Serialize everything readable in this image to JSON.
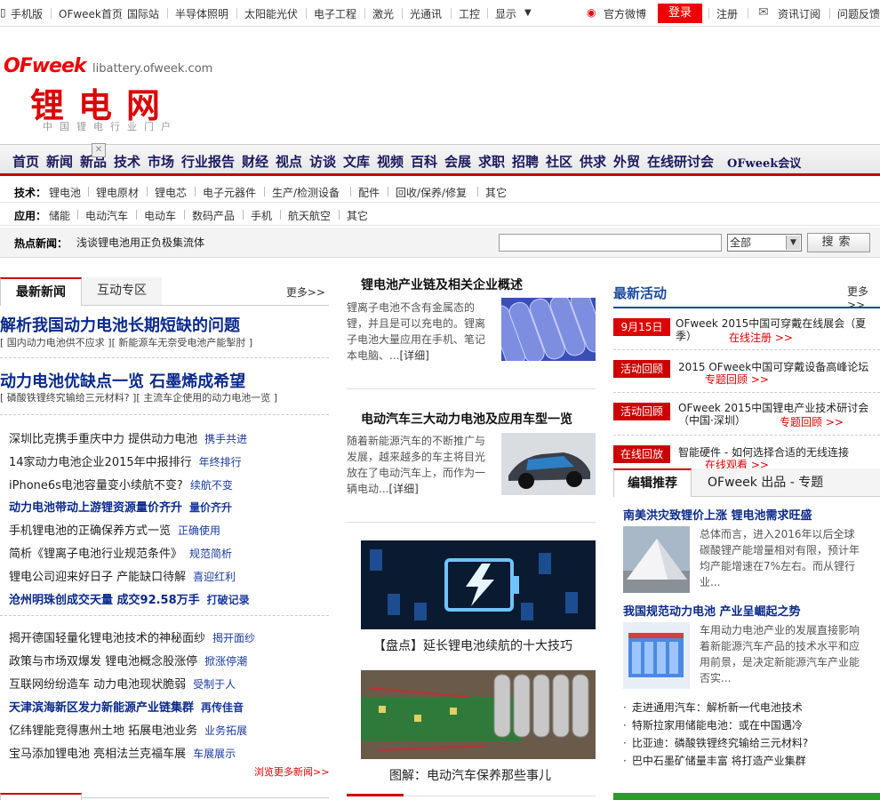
{
  "topbar": {
    "items": [
      "手机版",
      "OFweek首页",
      "国际站",
      "半导体照明",
      "太阳能光伏",
      "电子工程",
      "激光",
      "光通讯",
      "工控",
      "显示"
    ],
    "weibo": "官方微博",
    "login": "登录",
    "register": "注册",
    "subscribe": "资讯订阅",
    "feedback": "问题反馈"
  },
  "logo": {
    "brand": "OFweek",
    "domain": "libattery.ofweek.com",
    "title": "锂电网",
    "slogan": "中国锂电行业门户"
  },
  "mainnav": [
    "首页",
    "新闻",
    "新品",
    "技术",
    "市场",
    "行业报告",
    "财经",
    "视点",
    "访谈",
    "文库",
    "视频",
    "百科",
    "会展",
    "求职",
    "招聘",
    "社区",
    "供求",
    "外贸",
    "在线研讨会",
    "OFweek会议"
  ],
  "tech": {
    "label": "技术：",
    "items": [
      "锂电池",
      "锂电原材",
      "锂电芯",
      "电子元器件",
      "生产/检测设备",
      "配件",
      "回收/保养/修复",
      "其它"
    ]
  },
  "apply": {
    "label": "应用：",
    "items": [
      "储能",
      "电动汽车",
      "电动车",
      "数码产品",
      "手机",
      "航天航空",
      "其它"
    ]
  },
  "hot": {
    "label": "热点新闻：",
    "link": "浅谈锂电池用正负极集流体"
  },
  "search": {
    "value": "",
    "select": "全部",
    "button": "搜索"
  },
  "left": {
    "tab_news": "最新新闻",
    "tab_interact": "互动专区",
    "more": "更多>>",
    "headline1": "解析我国动力电池长期短缺的问题",
    "sub1": "[ 国内动力电池供不应求 ][ 新能源车无奈受电池产能掣肘 ]",
    "headline2": "动力电池优缺点一览 石墨烯成希望",
    "sub2": "[ 磷酸铁锂终究输给三元材料? ][ 主流车企使用的动力电池一览 ]",
    "list1": [
      {
        "text": "深圳比克携手重庆中力 提供动力电池",
        "tag": "携手共进",
        "bold": false
      },
      {
        "text": "14家动力电池企业2015年中报排行",
        "tag": "年终排行",
        "bold": false
      },
      {
        "text": "iPhone6s电池容量变小续航不变?",
        "tag": "续航不变",
        "bold": false
      },
      {
        "text": "动力电池带动上游锂资源量价齐升",
        "tag": "量价齐升",
        "bold": true
      },
      {
        "text": "手机锂电池的正确保养方式一览",
        "tag": "正确使用",
        "bold": false
      },
      {
        "text": "简析《锂离子电池行业规范条件》",
        "tag": "规范简析",
        "bold": false
      },
      {
        "text": "锂电公司迎来好日子 产能缺口待解",
        "tag": "喜迎红利",
        "bold": false
      },
      {
        "text": "沧州明珠创成交天量 成交92.58万手",
        "tag": "打破记录",
        "bold": true
      }
    ],
    "list2": [
      {
        "text": "揭开德国轻量化锂电池技术的神秘面纱",
        "tag": "揭开面纱",
        "bold": false
      },
      {
        "text": "政策与市场双爆发 锂电池概念股涨停",
        "tag": "掀涨停潮",
        "bold": false
      },
      {
        "text": "互联网纷纷造车 动力电池现状脆弱",
        "tag": "受制于人",
        "bold": false
      },
      {
        "text": "天津滨海新区发力新能源产业链集群",
        "tag": "再传佳音",
        "bold": true
      },
      {
        "text": "亿纬锂能竞得惠州土地 拓展电池业务",
        "tag": "业务拓展",
        "bold": false
      },
      {
        "text": "宝马添加锂电池 亮相法兰克福车展",
        "tag": "车展展示",
        "bold": false
      }
    ],
    "browse_more": "浏览更多新闻>>"
  },
  "middle": {
    "a1_title": "锂电池产业链及相关企业概述",
    "a1_text": "锂离子电池不含有金属态的锂，并且是可以充电的。锂离子电池大量应用在手机、笔记本电脑、...",
    "a1_detail": "[详细]",
    "a2_title": "电动汽车三大动力电池及应用车型一览",
    "a2_text": "随着新能源汽车的不断推广与发展，越来越多的车主将目光放在了电动汽车上，而作为一辆电动...",
    "a2_detail": "[详细]",
    "cap1": "【盘点】延长锂电池续航的十大技巧",
    "cap2": "图解：电动汽车保养那些事儿"
  },
  "right": {
    "title": "最新活动",
    "more": "更多>>",
    "activities": [
      {
        "badge": "9月15日",
        "title": "OFweek 2015中国可穿戴在线展会（夏季）",
        "link": "在线注册 >>"
      },
      {
        "badge": "活动回顾",
        "title": "2015 OFweek中国可穿戴设备高峰论坛",
        "link": "专题回顾 >>"
      },
      {
        "badge": "活动回顾",
        "title": "OFweek 2015中国锂电产业技术研讨会（中国·深圳）",
        "link": "专题回顾 >>"
      },
      {
        "badge": "在线回放",
        "title": "智能硬件 - 如何选择合适的无线连接",
        "link": "在线观看 >>"
      }
    ],
    "tab_editor": "编辑推荐",
    "tab_products": "OFweek 出品 - 专题",
    "ed1_title": "南美洪灾致锂价上涨 锂电池需求旺盛",
    "ed1_text": "总体而言，进入2016年以后全球碳酸锂产能增量相对有限，预计年均产能增速在7%左右。而从锂行业...",
    "ed2_title": "我国规范动力电池 产业呈崛起之势",
    "ed2_text": "车用动力电池产业的发展直接影响着新能源汽车产品的技术水平和应用前景，是决定新能源汽车产业能否实...",
    "bullets": [
      "走进通用汽车：解析新一代电池技术",
      "特斯拉家用储能电池：或在中国遇冷",
      "比亚迪：磷酸铁锂终究输给三元材料?",
      "巴中石墨矿储量丰富 将打造产业集群"
    ]
  },
  "colors": {
    "brand_red": "#dd0000",
    "link_blue": "#0a2a8c",
    "nav_text": "#1a1a60"
  }
}
